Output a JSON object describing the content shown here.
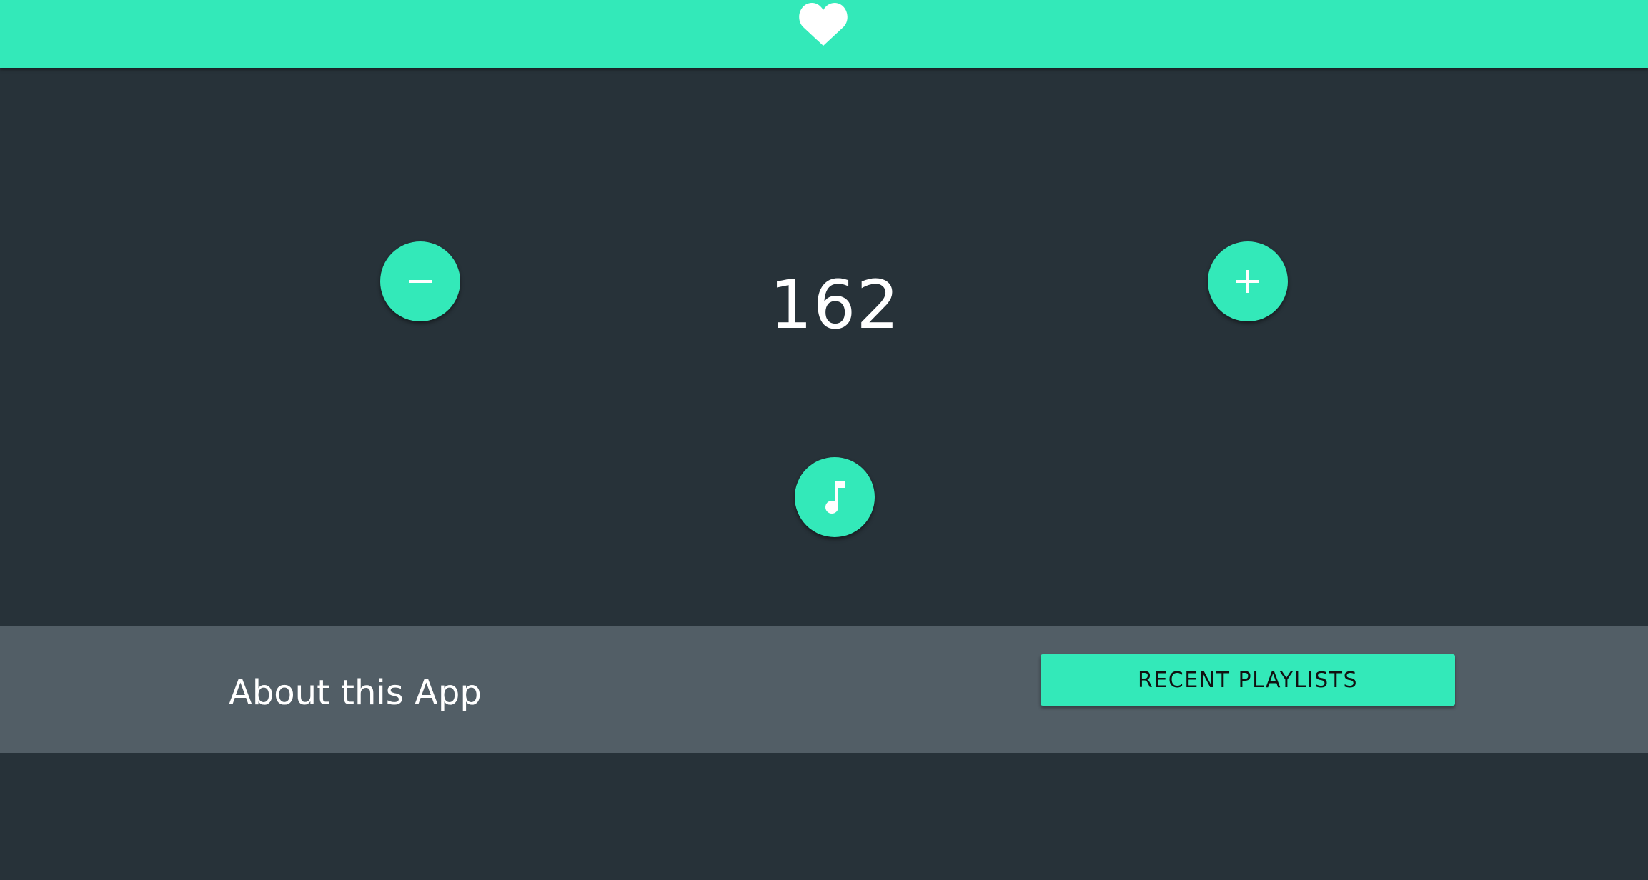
{
  "colors": {
    "accent": "#33e9b9",
    "background": "#273239",
    "footer_background": "#525e66",
    "text_light": "#ffffff",
    "text_dark": "#111111"
  },
  "header": {
    "icon": "heart-icon"
  },
  "tempo": {
    "value": "162",
    "decrease_icon": "minus-icon",
    "increase_icon": "plus-icon",
    "play_icon": "music-note-icon"
  },
  "footer": {
    "about_label": "About this App",
    "recent_playlists_label": "RECENT PLAYLISTS"
  }
}
